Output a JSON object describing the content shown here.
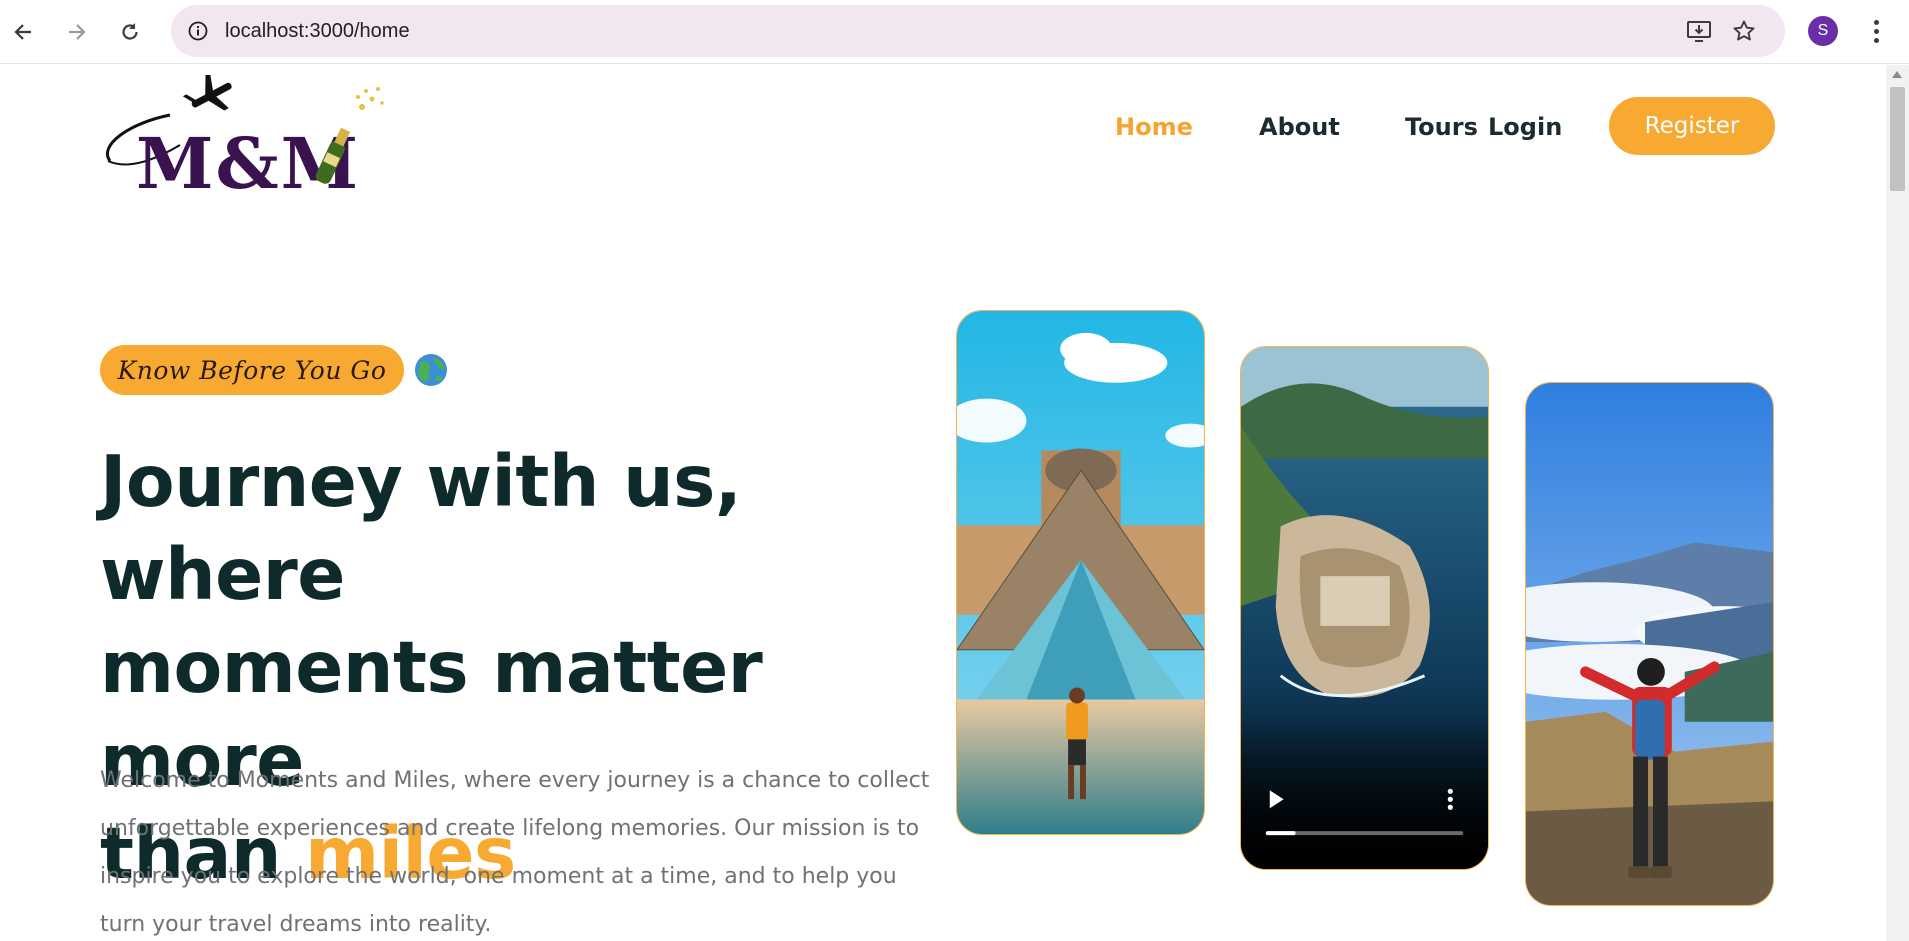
{
  "browser": {
    "url": "localhost:3000/home",
    "profile_initial": "S"
  },
  "header": {
    "brand": "M&M",
    "nav": [
      {
        "label": "Home",
        "active": true
      },
      {
        "label": "About",
        "active": false
      },
      {
        "label": "Tours",
        "active": false
      },
      {
        "label": "Login",
        "active": false
      }
    ],
    "register_label": "Register"
  },
  "hero": {
    "tag": "Know Before You Go",
    "headline_lines": [
      "Journey with us, where",
      "moments matter more",
      "than "
    ],
    "headline_accent": "miles",
    "paragraph": "Welcome to Moments and Miles, where every journey is a chance to collect unforgettable experiences and create lifelong memories. Our mission is to inspire you to explore the world, one moment at a time, and to help you turn your travel dreams into reality."
  },
  "colors": {
    "accent": "#f8a932",
    "heading": "#0f2a2a",
    "body_text": "#6f7274",
    "brand_purple": "#3b1250"
  },
  "icons": [
    "back-arrow-icon",
    "forward-arrow-icon",
    "reload-icon",
    "site-info-icon",
    "install-app-icon",
    "bookmark-star-icon",
    "menu-icon",
    "globe-icon",
    "play-icon",
    "video-options-icon"
  ],
  "video": {
    "progress": 0.15
  }
}
